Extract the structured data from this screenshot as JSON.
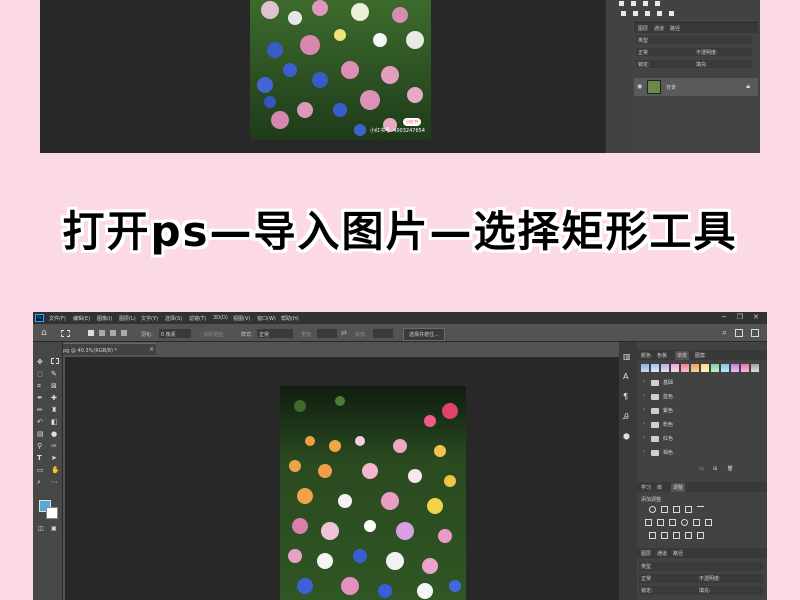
{
  "headline": "打开ps—导入图片—选择矩形工具",
  "window1": {
    "layers_tabs": [
      "图层",
      "通道",
      "路径"
    ],
    "search_kind": "类型",
    "blend_mode": "正常",
    "opacity_label": "不透明度:",
    "lock_label": "锁定:",
    "fill_label": "填充:",
    "layer_name": "背景",
    "watermark_badge": "小红书",
    "watermark_text": "小红书号: 4003247654"
  },
  "window2": {
    "ps_logo": "Ps",
    "menu": [
      "文件(F)",
      "编辑(E)",
      "图像(I)",
      "图层(L)",
      "文字(Y)",
      "选择(S)",
      "滤镜(T)",
      "3D(D)",
      "视图(V)",
      "窗口(W)",
      "帮助(H)"
    ],
    "feather_label": "羽化:",
    "feather_value": "0 像素",
    "antialias_label": "消除锯齿",
    "style_label": "样式:",
    "style_value": "正常",
    "width_label": "宽度:",
    "height_label": "高度:",
    "select_mask_button": "选择并遮住...",
    "doc_tab": "花花.jpg @ 40.3%(RGB/8) *",
    "close_x": "×",
    "panel_tabs": [
      "颜色",
      "色板",
      "渐变",
      "图案"
    ],
    "folders": [
      "基础",
      "蓝色",
      "紫色",
      "粉色",
      "红色",
      "褐色"
    ],
    "adjust_tabs": [
      "学习",
      "库",
      "调整"
    ],
    "adjust_title": "添加调整",
    "layers_tabs": [
      "图层",
      "通道",
      "路径"
    ],
    "blend_mode": "正常",
    "opacity_label": "不透明度:",
    "lock_label": "锁定:",
    "fill_label": "填充:",
    "search_kind": "类型",
    "colors": {
      "foreground": "#5aa6d6",
      "background": "#ffffff"
    }
  }
}
